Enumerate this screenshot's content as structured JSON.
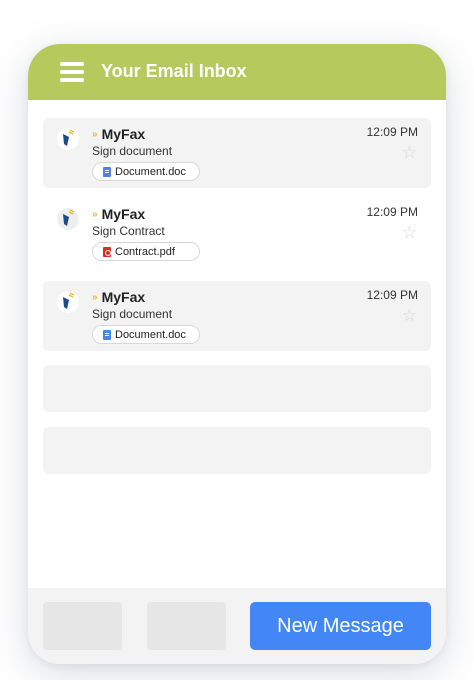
{
  "header": {
    "title": "Your Email Inbox"
  },
  "colors": {
    "header": "#b5c95c",
    "accent": "#4287f5",
    "flag": "#e8b923"
  },
  "messages": [
    {
      "sender": "MyFax",
      "subject": "Sign document",
      "time": "12:09 PM",
      "attachment": "Document.doc",
      "attachment_icon": "doc-file-icon"
    },
    {
      "sender": "MyFax",
      "subject": "Sign Contract",
      "time": "12:09 PM",
      "attachment": "Contract.pdf",
      "attachment_icon": "pdf-file-icon"
    },
    {
      "sender": "MyFax",
      "subject": "Sign document",
      "time": "12:09 PM",
      "attachment": "Document.doc",
      "attachment_icon": "doc-file-icon"
    }
  ],
  "footer": {
    "new_message_label": "New Message"
  }
}
